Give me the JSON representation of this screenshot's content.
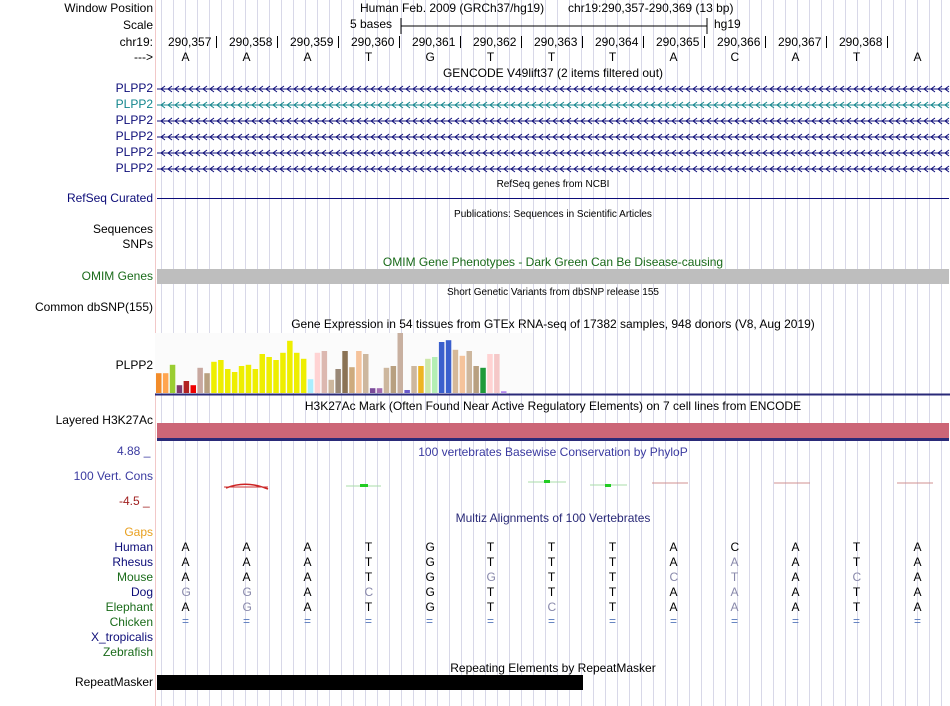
{
  "labels": {
    "window_position": "Window Position",
    "scale": "Scale",
    "chr": "chr19:",
    "strand": "--->",
    "refseq": "RefSeq Curated",
    "sequences": "Sequences",
    "snps": "SNPs",
    "omim": "OMIM Genes",
    "dbsnp": "Common dbSNP(155)",
    "gtex_gene": "PLPP2",
    "h3k27ac": "Layered H3K27Ac",
    "cons_max": "4.88 _",
    "cons_label": "100 Vert. Cons",
    "cons_min": "-4.5 _",
    "gaps": "Gaps",
    "repeatmasker": "RepeatMasker"
  },
  "header": {
    "assembly": "Human Feb. 2009 (GRCh37/hg19)",
    "position": "chr19:290,357-290,369 (13 bp)",
    "scale_text": "5 bases",
    "scale_db": "hg19"
  },
  "ruler": [
    "290,357",
    "290,358",
    "290,359",
    "290,360",
    "290,361",
    "290,362",
    "290,363",
    "290,364",
    "290,365",
    "290,366",
    "290,367",
    "290,368"
  ],
  "bases": [
    "A",
    "A",
    "A",
    "T",
    "G",
    "T",
    "T",
    "T",
    "A",
    "C",
    "A",
    "T",
    "A"
  ],
  "gencode": {
    "title": "GENCODE V49lift37 (2 items filtered out)",
    "tracks": [
      {
        "name": "PLPP2",
        "color": "#0c0c78"
      },
      {
        "name": "PLPP2",
        "color": "#12858c"
      },
      {
        "name": "PLPP2",
        "color": "#0c0c78"
      },
      {
        "name": "PLPP2",
        "color": "#0c0c78"
      },
      {
        "name": "PLPP2",
        "color": "#0c0c78"
      },
      {
        "name": "PLPP2",
        "color": "#0c0c78"
      }
    ]
  },
  "titles": {
    "refseq": "RefSeq genes from NCBI",
    "pubs": "Publications: Sequences in Scientific Articles",
    "omim": "OMIM Gene Phenotypes - Dark Green Can Be Disease-causing",
    "dbsnp": "Short Genetic Variants from dbSNP release 155",
    "gtex": "Gene Expression in 54 tissues from GTEx RNA-seq of 17382 samples, 948 donors (V8, Aug 2019)",
    "h3k27ac": "H3K27Ac Mark (Often Found Near Active Regulatory Elements) on 7 cell lines from ENCODE",
    "phylop": "100 vertebrates Basewise Conservation by PhyloP",
    "multiz": "Multiz Alignments of 100 Vertebrates",
    "rmsk": "Repeating Elements by RepeatMasker"
  },
  "gtex_bars": [
    {
      "v": 0.33,
      "c": "#f28c2a"
    },
    {
      "v": 0.33,
      "c": "#ffa54f"
    },
    {
      "v": 0.47,
      "c": "#9acd32"
    },
    {
      "v": 0.13,
      "c": "#7f3a6f"
    },
    {
      "v": 0.2,
      "c": "#b22222"
    },
    {
      "v": 0.13,
      "c": "#ee0000"
    },
    {
      "v": 0.42,
      "c": "#c8a8a0"
    },
    {
      "v": 0.33,
      "c": "#b8a080"
    },
    {
      "v": 0.52,
      "c": "#eeee00"
    },
    {
      "v": 0.55,
      "c": "#eeee00"
    },
    {
      "v": 0.4,
      "c": "#eeee00"
    },
    {
      "v": 0.35,
      "c": "#eeee00"
    },
    {
      "v": 0.45,
      "c": "#eeee00"
    },
    {
      "v": 0.47,
      "c": "#eeee00"
    },
    {
      "v": 0.4,
      "c": "#eeee00"
    },
    {
      "v": 0.65,
      "c": "#eeee00"
    },
    {
      "v": 0.6,
      "c": "#eeee00"
    },
    {
      "v": 0.55,
      "c": "#eeee00"
    },
    {
      "v": 0.67,
      "c": "#eeee00"
    },
    {
      "v": 0.87,
      "c": "#eeee00"
    },
    {
      "v": 0.67,
      "c": "#eeee00"
    },
    {
      "v": 0.57,
      "c": "#eeee00"
    },
    {
      "v": 0.23,
      "c": "#aaeeff"
    },
    {
      "v": 0.67,
      "c": "#ffd3d3"
    },
    {
      "v": 0.7,
      "c": "#dcb8b0"
    },
    {
      "v": 0.22,
      "c": "#cdb79e"
    },
    {
      "v": 0.4,
      "c": "#998877"
    },
    {
      "v": 0.7,
      "c": "#8b7355"
    },
    {
      "v": 0.43,
      "c": "#cdaa7d"
    },
    {
      "v": 0.7,
      "c": "#f5c39b"
    },
    {
      "v": 0.65,
      "c": "#cdb79e"
    },
    {
      "v": 0.08,
      "c": "#7b4b9b"
    },
    {
      "v": 0.08,
      "c": "#a36cb0"
    },
    {
      "v": 0.42,
      "c": "#cdb79e"
    },
    {
      "v": 0.45,
      "c": "#b8a080"
    },
    {
      "v": 1.0,
      "c": "#c8b0a0"
    },
    {
      "v": 0.05,
      "c": "#6a5acd"
    },
    {
      "v": 0.45,
      "c": "#cdb79e"
    },
    {
      "v": 0.45,
      "c": "#eeb422"
    },
    {
      "v": 0.57,
      "c": "#cde8a8"
    },
    {
      "v": 0.6,
      "c": "#b4eeb4"
    },
    {
      "v": 0.85,
      "c": "#3a5fcd"
    },
    {
      "v": 0.88,
      "c": "#3a5fcd"
    },
    {
      "v": 0.72,
      "c": "#d5b898"
    },
    {
      "v": 0.62,
      "c": "#f5c39b"
    },
    {
      "v": 0.7,
      "c": "#cdb79e"
    },
    {
      "v": 0.45,
      "c": "#b8a080"
    },
    {
      "v": 0.42,
      "c": "#1f9a3a"
    },
    {
      "v": 0.65,
      "c": "#ffd3d3"
    },
    {
      "v": 0.65,
      "c": "#f5c8c8"
    },
    {
      "v": 0.03,
      "c": "#b48aee"
    }
  ],
  "alignments": [
    {
      "species": "Human",
      "color": "#0c0c78",
      "bases": [
        "A",
        "A",
        "A",
        "T",
        "G",
        "T",
        "T",
        "T",
        "A",
        "C",
        "A",
        "T",
        "A"
      ],
      "matches": [
        1,
        1,
        1,
        1,
        1,
        1,
        1,
        1,
        1,
        1,
        1,
        1,
        1
      ]
    },
    {
      "species": "Rhesus",
      "color": "#0c0c78",
      "bases": [
        "A",
        "A",
        "A",
        "T",
        "G",
        "T",
        "T",
        "T",
        "A",
        "A",
        "A",
        "T",
        "A"
      ],
      "matches": [
        1,
        1,
        1,
        1,
        1,
        1,
        1,
        1,
        1,
        0,
        1,
        1,
        1
      ]
    },
    {
      "species": "Mouse",
      "color": "#1a6b1a",
      "bases": [
        "A",
        "A",
        "A",
        "T",
        "G",
        "G",
        "T",
        "T",
        "C",
        "T",
        "A",
        "C",
        "A"
      ],
      "matches": [
        1,
        1,
        1,
        1,
        1,
        0,
        1,
        1,
        0,
        0,
        1,
        0,
        1
      ]
    },
    {
      "species": "Dog",
      "color": "#0c0c78",
      "bases": [
        "G",
        "G",
        "A",
        "C",
        "G",
        "T",
        "T",
        "T",
        "A",
        "A",
        "A",
        "T",
        "A"
      ],
      "matches": [
        0,
        0,
        1,
        0,
        1,
        1,
        1,
        1,
        1,
        0,
        1,
        1,
        1
      ]
    },
    {
      "species": "Elephant",
      "color": "#1a6b1a",
      "bases": [
        "A",
        "G",
        "A",
        "T",
        "G",
        "T",
        "C",
        "T",
        "A",
        "A",
        "A",
        "T",
        "A"
      ],
      "matches": [
        1,
        0,
        1,
        1,
        1,
        1,
        0,
        1,
        1,
        0,
        1,
        1,
        1
      ]
    },
    {
      "species": "Chicken",
      "color": "#1a6b1a",
      "bases": [
        "=",
        "=",
        "=",
        "=",
        "=",
        "=",
        "=",
        "=",
        "=",
        "=",
        "=",
        "=",
        "="
      ],
      "matches": [
        0,
        0,
        0,
        0,
        0,
        0,
        0,
        0,
        0,
        0,
        0,
        0,
        0
      ]
    },
    {
      "species": "X_tropicalis",
      "color": "#0c0c78",
      "bases": [
        "",
        "",
        "",
        "",
        "",
        "",
        "",
        "",
        "",
        "",
        "",
        "",
        ""
      ],
      "matches": []
    },
    {
      "species": "Zebrafish",
      "color": "#1a6b1a",
      "bases": [
        "",
        "",
        "",
        "",
        "",
        "",
        "",
        "",
        "",
        "",
        "",
        "",
        ""
      ],
      "matches": []
    }
  ],
  "colors": {
    "label_blue": "#0c0c78",
    "omim_label": "#1a6b1a",
    "cons_blue": "#3a3aa0",
    "cons_red": "#a02020",
    "gaps_orange": "#e8a020",
    "h3k27ac_bar": "#cc6677",
    "omim_bar": "#bebebe",
    "mismatch": "#8888aa"
  }
}
